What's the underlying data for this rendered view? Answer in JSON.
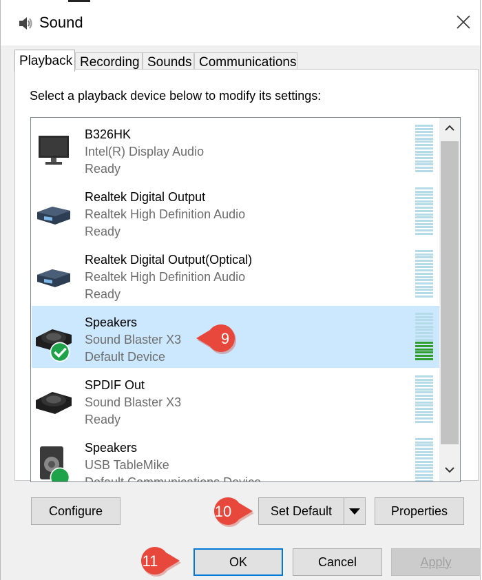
{
  "window": {
    "title": "Sound",
    "close_glyph": "✕"
  },
  "tabs": [
    {
      "label": "Playback",
      "active": true
    },
    {
      "label": "Recording",
      "active": false
    },
    {
      "label": "Sounds",
      "active": false
    },
    {
      "label": "Communications",
      "active": false
    }
  ],
  "instruction": "Select a playback device below to modify its settings:",
  "devices": [
    {
      "name": "B326HK",
      "subtitle": "Intel(R) Display Audio",
      "status": "Ready",
      "icon": "monitor-icon",
      "selected": false,
      "level": 0
    },
    {
      "name": "Realtek Digital Output",
      "subtitle": "Realtek High Definition Audio",
      "status": "Ready",
      "icon": "digital-output-icon",
      "selected": false,
      "level": 0
    },
    {
      "name": "Realtek Digital Output(Optical)",
      "subtitle": "Realtek High Definition Audio",
      "status": "Ready",
      "icon": "digital-output-icon",
      "selected": false,
      "level": 0
    },
    {
      "name": "Speakers",
      "subtitle": "Sound Blaster X3",
      "status": "Default Device",
      "icon": "sound-blaster-icon",
      "selected": true,
      "level": 0.4
    },
    {
      "name": "SPDIF Out",
      "subtitle": "Sound Blaster X3",
      "status": "Ready",
      "icon": "sound-blaster-icon",
      "selected": false,
      "level": 0
    },
    {
      "name": "Speakers",
      "subtitle": "USB TableMike",
      "status": "Default Communications Device",
      "icon": "usb-speaker-icon",
      "selected": false,
      "level": 0
    }
  ],
  "buttons": {
    "configure": "Configure",
    "set_default": "Set Default",
    "properties": "Properties",
    "ok": "OK",
    "cancel": "Cancel",
    "apply": "Apply"
  },
  "callouts": [
    "9",
    "10",
    "11"
  ],
  "colors": {
    "selection": "#cce8ff",
    "callout": "#e8483c",
    "check": "#1fa34a",
    "meter_idle": "#b6dbe8",
    "meter_active": "#2f9e2f",
    "focus_border": "#0078d7"
  }
}
